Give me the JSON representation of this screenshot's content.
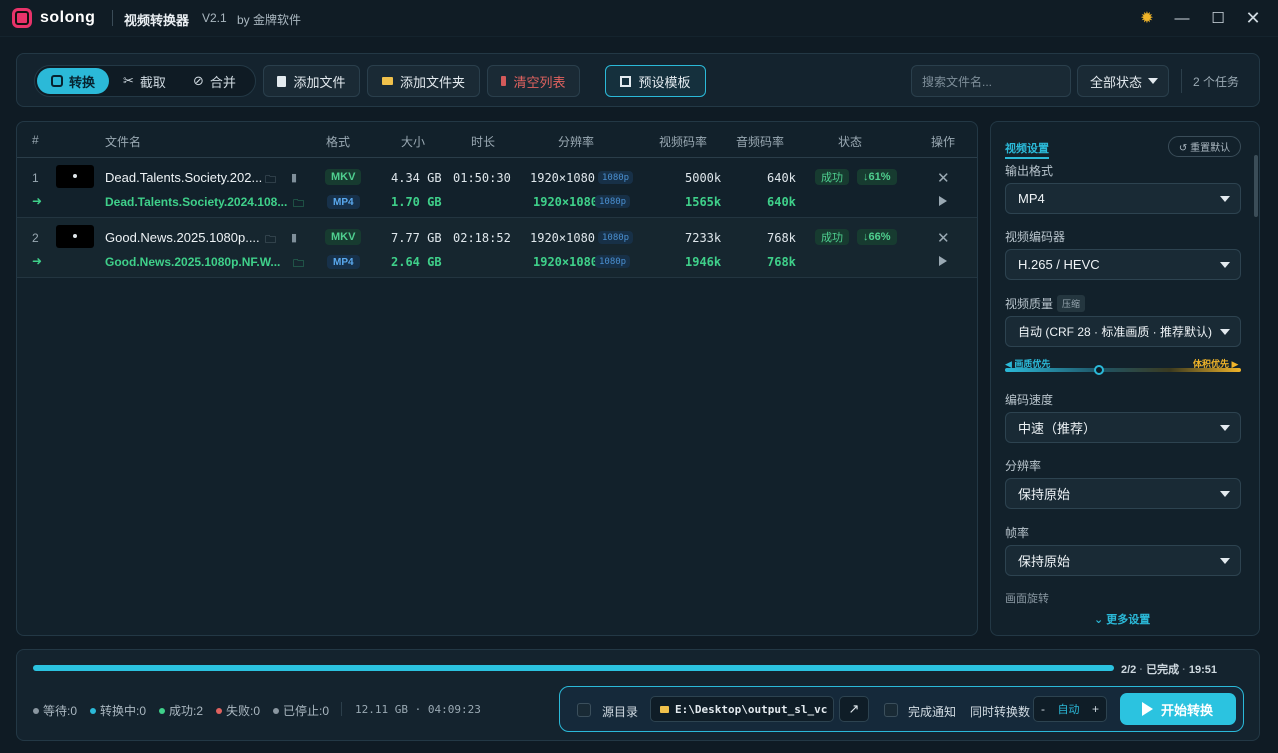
{
  "titlebar": {
    "brand": "solong",
    "app_name": "视频转换器",
    "version": "V2.1",
    "by": "by 金牌软件"
  },
  "toolbar": {
    "modes": [
      "转换",
      "截取",
      "合并"
    ],
    "add_file": "添加文件",
    "add_folder": "添加文件夹",
    "clear_list": "清空列表",
    "preset": "预设模板",
    "search_placeholder": "搜索文件名...",
    "status_filter": "全部状态",
    "task_count": "2 个任务"
  },
  "table": {
    "headers": [
      "#",
      "文件名",
      "格式",
      "大小",
      "时长",
      "分辨率",
      "视频码率",
      "音频码率",
      "状态",
      "操作"
    ],
    "rows": [
      {
        "index": "1",
        "source": {
          "name": "Dead.Talents.Society.202...",
          "format": "MKV",
          "size": "4.34 GB",
          "duration": "01:50:30",
          "resolution": "1920×1080",
          "res_tag": "1080p",
          "video_bitrate": "5000k",
          "audio_bitrate": "640k"
        },
        "output": {
          "name": "Dead.Talents.Society.2024.108...",
          "format": "MP4",
          "size": "1.70 GB",
          "resolution": "1920×1080",
          "res_tag": "1080p",
          "video_bitrate": "1565k",
          "audio_bitrate": "640k"
        },
        "status": "成功",
        "reduction": "↓61%"
      },
      {
        "index": "2",
        "source": {
          "name": "Good.News.2025.1080p....",
          "format": "MKV",
          "size": "7.77 GB",
          "duration": "02:18:52",
          "resolution": "1920×1080",
          "res_tag": "1080p",
          "video_bitrate": "7233k",
          "audio_bitrate": "768k"
        },
        "output": {
          "name": "Good.News.2025.1080p.NF.W...",
          "format": "MP4",
          "size": "2.64 GB",
          "resolution": "1920×1080",
          "res_tag": "1080p",
          "video_bitrate": "1946k",
          "audio_bitrate": "768k"
        },
        "status": "成功",
        "reduction": "↓66%"
      }
    ]
  },
  "settings": {
    "title": "视频设置",
    "reset": "↺ 重置默认",
    "output_format_label": "输出格式",
    "output_format": "MP4",
    "codec_label": "视频编码器",
    "codec": "H.265 / HEVC",
    "quality_label": "视频质量",
    "quality_tag": "压缩",
    "quality": "自动 (CRF 28 · 标准画质 · 推荐默认)",
    "quality_left": "◀ 画质优先",
    "quality_right": "体积优先 ▶",
    "quality_level": 0.4,
    "speed_label": "编码速度",
    "speed": "中速（推荐）",
    "resolution_label": "分辨率",
    "resolution": "保持原始",
    "fps_label": "帧率",
    "fps": "保持原始",
    "rotation_label": "画面旋转",
    "more": "⌄ 更多设置"
  },
  "bottom": {
    "progress": 1.0,
    "progress_count": "2/2",
    "progress_status": "已完成",
    "progress_time": "19:51",
    "stats": [
      {
        "label": "等待:0",
        "color": "#8a96a0"
      },
      {
        "label": "转换中:0",
        "color": "#2bb9d8"
      },
      {
        "label": "成功:2",
        "color": "#3fd08a"
      },
      {
        "label": "失败:0",
        "color": "#e0625f"
      },
      {
        "label": "已停止:0",
        "color": "#8a96a0"
      }
    ],
    "total": "12.11 GB · 04:09:23",
    "source_dir": "源目录",
    "output_path": "E:\\Desktop\\output_sl_vc",
    "notify": "完成通知",
    "concurrent_label": "同时转换数",
    "concurrent_value": "自动",
    "start": "开始转换"
  },
  "colors": {
    "accent": "#2bc3e0",
    "success": "#3fd08a",
    "danger": "#e0625f",
    "warning": "#f0b429"
  }
}
